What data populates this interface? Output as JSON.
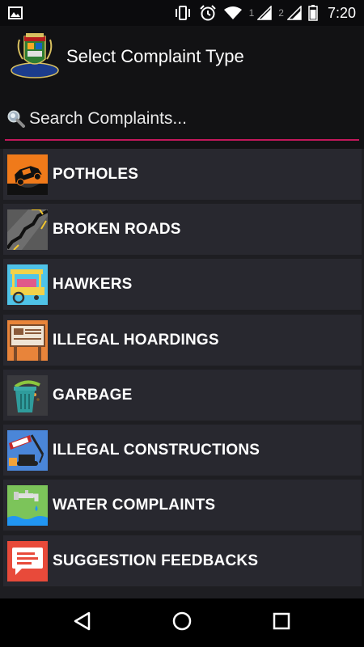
{
  "status_bar": {
    "icons": [
      "image-notification-icon",
      "vibrate-icon",
      "alarm-icon",
      "wifi-icon",
      "signal-sim1-icon",
      "signal-sim2-icon",
      "battery-icon"
    ],
    "sim1_label": "1",
    "sim2_label": "2",
    "time": "7:20"
  },
  "header": {
    "title": "Select Complaint Type",
    "logo": "municipal-crest-logo"
  },
  "search": {
    "placeholder": "Search Complaints...",
    "icon": "search-icon",
    "underline_color": "#c2185b"
  },
  "complaints": [
    {
      "label": "POTHOLES",
      "icon": "pothole-car-icon"
    },
    {
      "label": "BROKEN ROADS",
      "icon": "broken-road-icon"
    },
    {
      "label": "HAWKERS",
      "icon": "hawker-cart-icon"
    },
    {
      "label": "ILLEGAL HOARDINGS",
      "icon": "hoarding-billboard-icon"
    },
    {
      "label": "GARBAGE",
      "icon": "garbage-bin-icon"
    },
    {
      "label": "ILLEGAL CONSTRUCTIONS",
      "icon": "illegal-construction-icon"
    },
    {
      "label": "WATER COMPLAINTS",
      "icon": "water-tap-icon"
    },
    {
      "label": "SUGGESTION FEEDBACKS",
      "icon": "feedback-bubble-icon"
    }
  ],
  "nav": {
    "icons": [
      "back-icon",
      "home-icon",
      "recents-icon"
    ]
  },
  "colors": {
    "background": "#1e1e22",
    "item_background": "#28282f",
    "header_background": "#121214"
  }
}
